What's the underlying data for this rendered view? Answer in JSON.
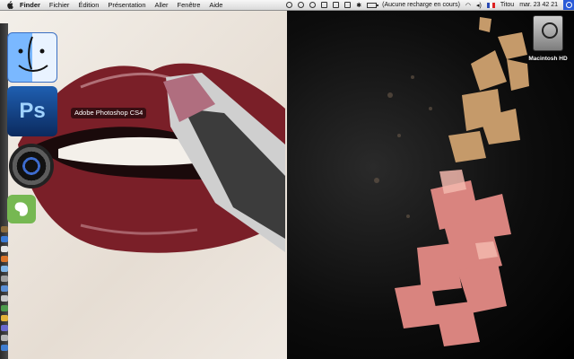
{
  "menubar": {
    "items": [
      "Finder",
      "Fichier",
      "Édition",
      "Présentation",
      "Aller",
      "Fenêtre",
      "Aide"
    ],
    "status_battery": "(Aucune recharge en cours)",
    "user": "Titou",
    "clock": "mar. 23 42 21"
  },
  "dock": {
    "tooltip": "Adobe Photoshop CS4",
    "apps": [
      "finder-icon",
      "photoshop-icon",
      "camera-icon",
      "evernote-icon"
    ],
    "photoshop_glyph": "Ps"
  },
  "desktop": {
    "disk_label": "Macintosh HD"
  },
  "colors": {
    "menubar": "#e6e6e6",
    "lips": "#7a1f28",
    "powder_gold": "#c59a6a",
    "powder_pink": "#d9847f"
  }
}
